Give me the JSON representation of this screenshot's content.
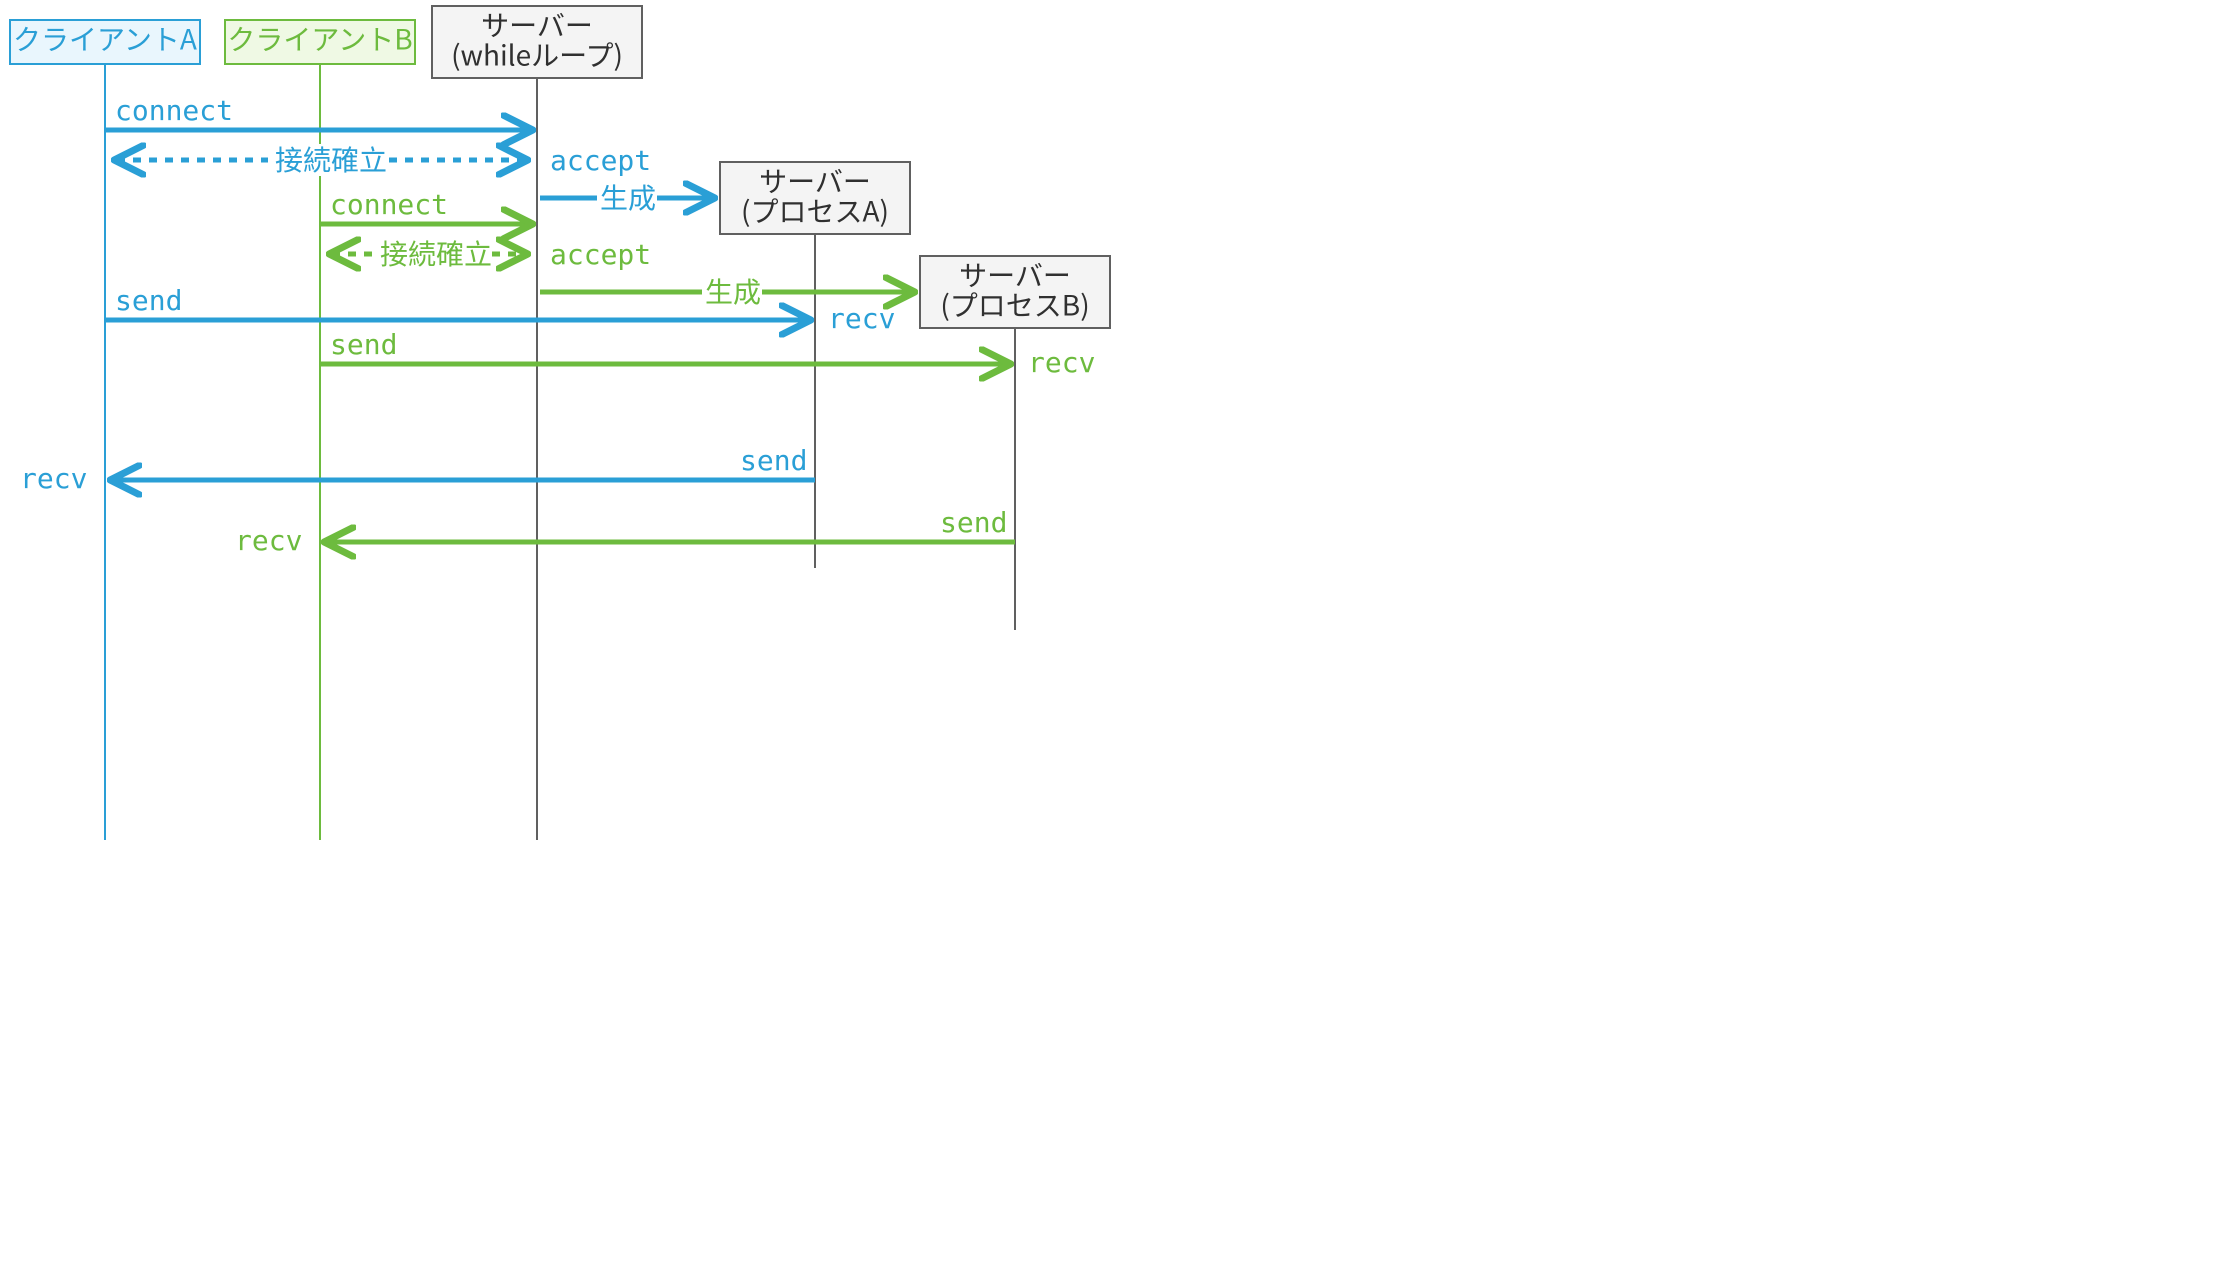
{
  "participants": {
    "clientA": "クライアントA",
    "clientB": "クライアントB",
    "server_loop_l1": "サーバー",
    "server_loop_l2": "(whileループ)",
    "server_procA_l1": "サーバー",
    "server_procA_l2": "(プロセスA)",
    "server_procB_l1": "サーバー",
    "server_procB_l2": "(プロセスB)"
  },
  "labels": {
    "connect": "connect",
    "accept": "accept",
    "established": "接続確立",
    "spawn": "生成",
    "send": "send",
    "recv": "recv"
  },
  "colors": {
    "blue": "#2a9fd6",
    "green": "#6dbb3e",
    "grey": "#606060",
    "box_blue_fill": "#e9f6fd",
    "box_green_fill": "#eff9e4",
    "box_grey_fill": "#f4f4f4"
  }
}
